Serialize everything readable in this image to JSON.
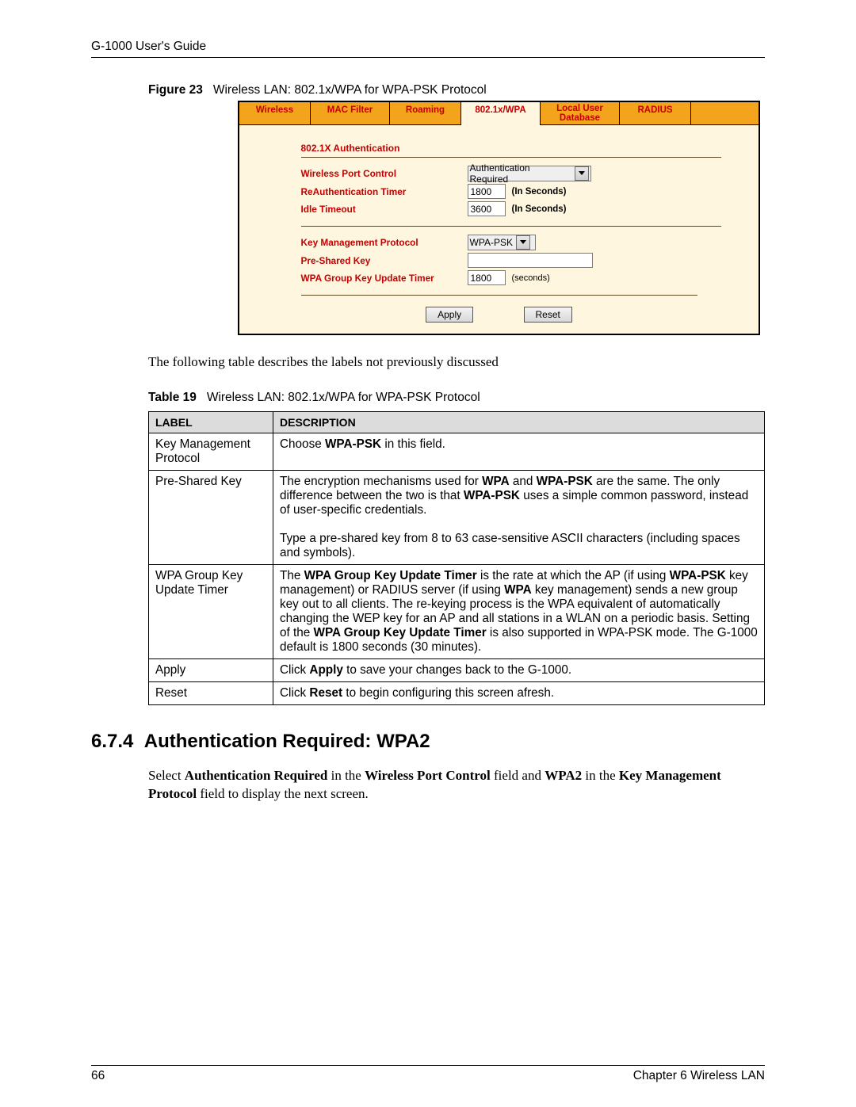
{
  "header": {
    "guide": "G-1000 User's Guide"
  },
  "figure": {
    "num": "Figure 23",
    "caption": "Wireless LAN: 802.1x/WPA for WPA-PSK Protocol"
  },
  "tabs": [
    "Wireless",
    "MAC Filter",
    "Roaming",
    "802.1x/WPA",
    "Local User Database",
    "RADIUS"
  ],
  "ui": {
    "section_auth": "802.1X Authentication",
    "labels": {
      "port_control": "Wireless Port Control",
      "reauth_timer": "ReAuthentication Timer",
      "idle_timeout": "Idle Timeout",
      "key_mgmt": "Key Management Protocol",
      "psk": "Pre-Shared Key",
      "group_key": "WPA Group Key Update Timer"
    },
    "values": {
      "port_control": "Authentication Required",
      "reauth_timer": "1800",
      "idle_timeout": "3600",
      "key_mgmt": "WPA-PSK",
      "psk": "",
      "group_key": "1800"
    },
    "suffix_seconds_bold": "(In Seconds)",
    "suffix_seconds": "(seconds)",
    "btn_apply": "Apply",
    "btn_reset": "Reset"
  },
  "para_intro": "The following table describes the labels not previously discussed",
  "table_caption": {
    "num": "Table 19",
    "caption": "Wireless LAN: 802.1x/WPA for WPA-PSK Protocol"
  },
  "table": {
    "head": {
      "c0": "LABEL",
      "c1": "DESCRIPTION"
    },
    "rows": [
      {
        "label": "Key Management Protocol"
      },
      {
        "label": "Pre-Shared Key"
      },
      {
        "label": "WPA Group Key Update Timer"
      },
      {
        "label": "Apply"
      },
      {
        "label": "Reset"
      }
    ]
  },
  "section": {
    "num": "6.7.4",
    "title": "Authentication Required: WPA2"
  },
  "footer": {
    "page": "66",
    "chapter": "Chapter 6 Wireless LAN"
  }
}
